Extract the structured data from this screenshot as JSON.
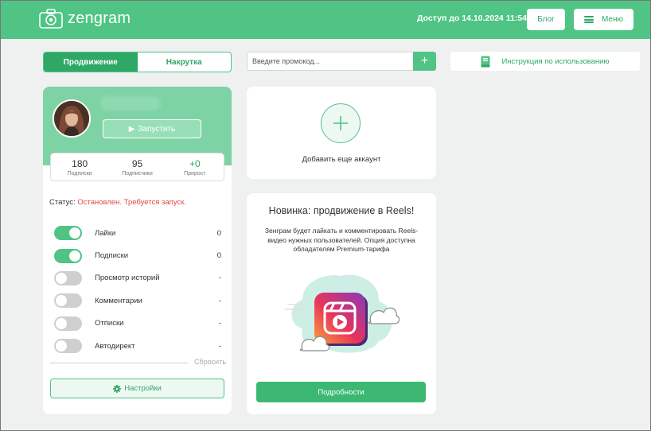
{
  "header": {
    "logo_text": "zengram",
    "access_text": "Доступ до 14.10.2024 11:54",
    "blog_label": "Блог",
    "menu_label": "Меню"
  },
  "tabs": [
    {
      "label": "Продвижение",
      "active": true
    },
    {
      "label": "Накрутка",
      "active": false
    }
  ],
  "promo": {
    "placeholder": "Введите промокод...",
    "button": "+"
  },
  "instructions_label": "Инструкция по использованию",
  "account": {
    "start_label": "Запустить",
    "stats": [
      {
        "value": "180",
        "label": "Подписки"
      },
      {
        "value": "95",
        "label": "Подписчики"
      },
      {
        "value": "+0",
        "label": "Прирост"
      }
    ],
    "status_label": "Статус:",
    "status_value": "Остановлен. Требуется запуск.",
    "options": [
      {
        "label": "Лайки",
        "value": "0",
        "on": true
      },
      {
        "label": "Подписки",
        "value": "0",
        "on": true
      },
      {
        "label": "Просмотр историй",
        "value": "-",
        "on": false
      },
      {
        "label": "Комментарии",
        "value": "-",
        "on": false
      },
      {
        "label": "Отписки",
        "value": "-",
        "on": false
      },
      {
        "label": "Автодирект",
        "value": "-",
        "on": false
      }
    ],
    "reset_label": "Сбросить",
    "settings_label": "Настройки"
  },
  "add_account_label": "Добавить еще аккаунт",
  "reels": {
    "title": "Новинка: продвижение в Reels!",
    "description": "Зенграм будет лайкать и комментировать Reels-видео нужных пользователей. Опция доступна обладателям Premium-тарифа",
    "details_label": "Подробности"
  },
  "colors": {
    "brand": "#4fc485",
    "brand_dark": "#2fa866",
    "status_red": "#e04848"
  }
}
